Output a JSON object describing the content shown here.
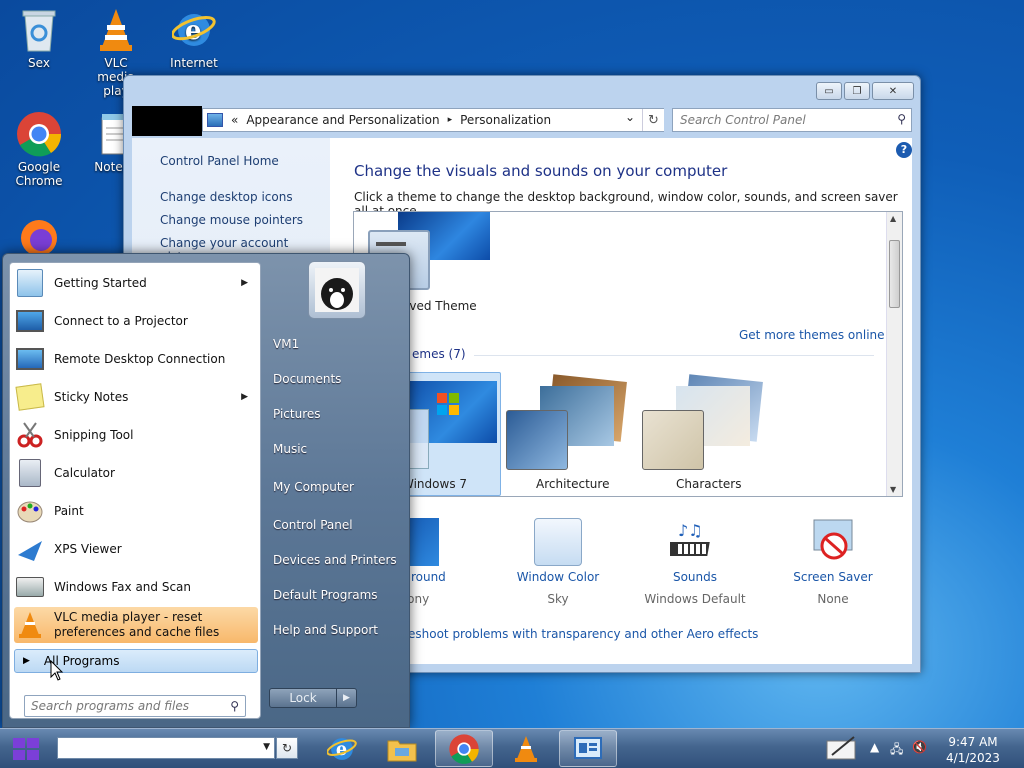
{
  "desktop": {
    "icons": [
      {
        "label": "Sex"
      },
      {
        "label": "VLC media play"
      },
      {
        "label": "Internet"
      },
      {
        "label": "Google Chrome"
      },
      {
        "label": "Notepa"
      }
    ]
  },
  "control_panel": {
    "breadcrumb": {
      "chevron": "«",
      "crumb1": "Appearance and Personalization",
      "sep": "▸",
      "crumb2": "Personalization",
      "dropdown": "⌄",
      "refresh": "↻"
    },
    "search_placeholder": "Search Control Panel",
    "window_buttons": {
      "minimize": "▭",
      "restore": "❐",
      "close": "✕"
    },
    "left_links": {
      "home": "Control Panel Home",
      "desktop_icons": "Change desktop icons",
      "mouse_pointers": "Change mouse pointers",
      "account_picture": "Change your account picture"
    },
    "main": {
      "title": "Change the visuals and sounds on your computer",
      "description": "Click a theme to change the desktop background, window color, sounds, and screen saver all at once.",
      "help": "?",
      "unsaved_theme": "aved Theme",
      "more_themes": "Get more themes online",
      "aero_header": "emes (7)",
      "themes": [
        {
          "name": "Windows 7"
        },
        {
          "name": "Architecture"
        },
        {
          "name": "Characters"
        }
      ],
      "bottom": {
        "background": {
          "title": "Background",
          "sub": "rmony"
        },
        "window_color": {
          "title": "Window Color",
          "sub": "Sky"
        },
        "sounds": {
          "title": "Sounds",
          "sub": "Windows Default"
        },
        "screen_saver": {
          "title": "Screen Saver",
          "sub": "None"
        }
      },
      "troubleshoot": "eshoot problems with transparency and other Aero effects"
    }
  },
  "start_menu": {
    "programs": [
      {
        "label": "Getting Started",
        "arrow": "▶"
      },
      {
        "label": "Connect to a Projector",
        "arrow": ""
      },
      {
        "label": "Remote Desktop Connection",
        "arrow": ""
      },
      {
        "label": "Sticky Notes",
        "arrow": "▶"
      },
      {
        "label": "Snipping Tool",
        "arrow": ""
      },
      {
        "label": "Calculator",
        "arrow": ""
      },
      {
        "label": "Paint",
        "arrow": ""
      },
      {
        "label": "XPS Viewer",
        "arrow": ""
      },
      {
        "label": "Windows Fax and Scan",
        "arrow": ""
      }
    ],
    "vlc_line1": "VLC media player - reset",
    "vlc_line2": "preferences and cache files",
    "all_programs": "All Programs",
    "search_placeholder": "Search programs and files",
    "right": {
      "user": "VM1",
      "documents": "Documents",
      "pictures": "Pictures",
      "music": "Music",
      "computer": "My Computer",
      "control_panel": "Control Panel",
      "devices": "Devices and Printers",
      "defaults": "Default Programs",
      "help": "Help and Support"
    },
    "lock": "Lock",
    "lock_arrow": "▶"
  },
  "taskbar": {
    "time": "9:47 AM",
    "date": "4/1/2023",
    "refresh": "↻",
    "dropdown": "▼"
  }
}
